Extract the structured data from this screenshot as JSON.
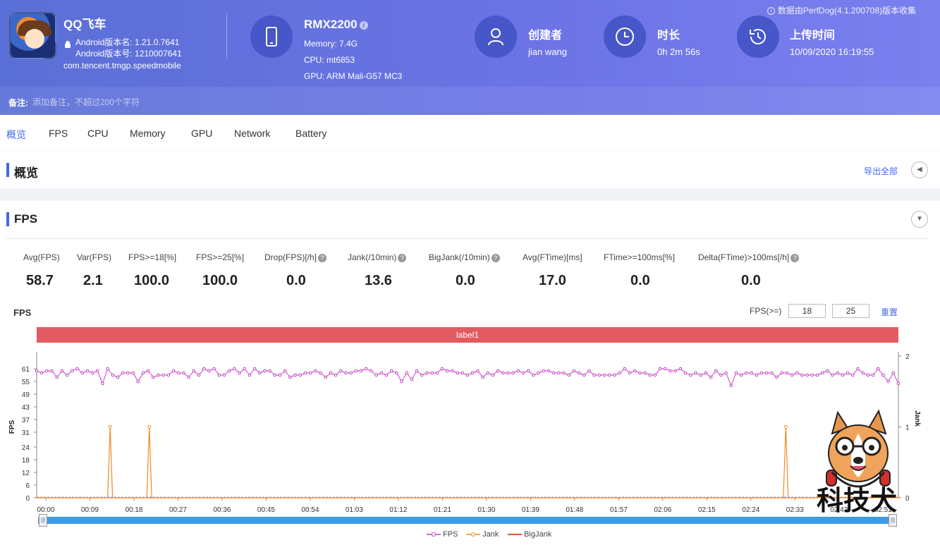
{
  "app": {
    "name": "QQ飞车",
    "version_name": "Android版本名: 1.21.0.7641",
    "version_code": "Android版本号: 1210007641",
    "package": "com.tencent.tmgp.speedmobile"
  },
  "device": {
    "name": "RMX2200",
    "memory": "Memory: 7.4G",
    "cpu": "CPU: mt6853",
    "gpu": "GPU: ARM Mali-G57 MC3"
  },
  "creator": {
    "title": "创建者",
    "value": "jian wang"
  },
  "duration": {
    "title": "时长",
    "value": "0h 2m 56s"
  },
  "upload": {
    "title": "上传时间",
    "value": "10/09/2020 16:19:55"
  },
  "perfdog_note": "数据由PerfDog(4.1.200708)版本收集",
  "note": {
    "label": "备注:",
    "placeholder": "添加备注，不超过200个字符"
  },
  "tabs": [
    "概览",
    "FPS",
    "CPU",
    "Memory",
    "GPU",
    "Network",
    "Battery"
  ],
  "overview": {
    "title": "概览",
    "export": "导出全部"
  },
  "fps_section": {
    "title": "FPS",
    "metrics": [
      {
        "label": "Avg(FPS)",
        "value": "58.7",
        "help": false
      },
      {
        "label": "Var(FPS)",
        "value": "2.1",
        "help": false
      },
      {
        "label": "FPS>=18[%]",
        "value": "100.0",
        "help": false
      },
      {
        "label": "FPS>=25[%]",
        "value": "100.0",
        "help": false
      },
      {
        "label": "Drop(FPS)[/h]",
        "value": "0.0",
        "help": true
      },
      {
        "label": "Jank(/10min)",
        "value": "13.6",
        "help": true
      },
      {
        "label": "BigJank(/10min)",
        "value": "0.0",
        "help": true
      },
      {
        "label": "Avg(FTime)[ms]",
        "value": "17.0",
        "help": false
      },
      {
        "label": "FTime>=100ms[%]",
        "value": "0.0",
        "help": false
      },
      {
        "label": "Delta(FTime)>100ms[/h]",
        "value": "0.0",
        "help": true
      }
    ],
    "chart_title": "FPS",
    "threshold_label": "FPS(>=)",
    "threshold_1": "18",
    "threshold_2": "25",
    "reset": "重置",
    "label_bar": "label1"
  },
  "watermark": "科技犬",
  "colors": {
    "header": "#5a6fd6",
    "accent": "#4169e1",
    "label_bar": "#e35a61",
    "fps": "#c43fc4",
    "jank": "#f08a24",
    "bigjank": "#e0552a",
    "slider": "#3a9be8"
  },
  "chart_data": {
    "type": "line",
    "title": "",
    "xlabel": "",
    "ylabel": "FPS",
    "y2label": "Jank",
    "y_ticks": [
      0,
      6,
      12,
      18,
      24,
      31,
      37,
      43,
      49,
      55,
      61
    ],
    "y_range": [
      0,
      67
    ],
    "y2_ticks": [
      0,
      1,
      2
    ],
    "y2_range": [
      0,
      2
    ],
    "x_ticks": [
      "00:00",
      "00:09",
      "00:18",
      "00:27",
      "00:36",
      "00:45",
      "00:54",
      "01:03",
      "01:12",
      "01:21",
      "01:30",
      "01:39",
      "01:48",
      "01:57",
      "02:06",
      "02:15",
      "02:24",
      "02:33",
      "02:42",
      "02:51"
    ],
    "x_range_seconds": [
      0,
      176
    ],
    "series": [
      {
        "name": "FPS",
        "values": [
          60,
          59,
          60,
          60,
          57,
          60,
          58,
          60,
          61,
          59,
          60,
          59,
          60,
          54,
          61,
          58,
          57,
          59,
          59,
          59,
          55,
          59,
          60,
          57,
          58,
          58,
          58,
          60,
          59,
          59,
          57,
          60,
          58,
          61,
          60,
          61,
          58,
          58,
          60,
          61,
          59,
          61,
          58,
          61,
          59,
          60,
          60,
          58,
          58,
          60,
          57,
          58,
          58,
          59,
          59,
          60,
          59,
          57,
          59,
          58,
          60,
          59,
          59,
          60,
          60,
          61,
          60,
          58,
          59,
          58,
          60,
          59,
          55,
          59,
          56,
          60,
          58,
          59,
          59,
          59,
          61,
          60,
          60,
          59,
          59,
          58,
          59,
          60,
          57,
          59,
          58,
          60,
          59,
          59,
          59,
          60,
          59,
          60,
          58,
          59,
          60,
          60,
          59,
          59,
          59,
          58,
          60,
          59,
          58,
          60,
          58,
          58,
          58,
          58,
          58,
          59,
          61,
          59,
          60,
          59,
          59,
          58,
          58,
          61,
          61,
          60,
          60,
          61,
          59,
          58,
          59,
          58,
          59,
          57,
          60,
          58,
          59,
          53,
          59,
          58,
          59,
          59,
          58,
          59,
          59,
          59,
          57,
          59,
          59,
          58,
          59,
          58,
          58,
          58,
          58,
          59,
          60,
          58,
          59,
          58,
          59,
          58,
          61,
          59,
          58,
          58,
          61,
          58,
          55,
          59,
          54
        ]
      },
      {
        "name": "Jank",
        "spikes_seconds": [
          15,
          23,
          153
        ],
        "spike_value": 1,
        "baseline": 0
      },
      {
        "name": "BigJank",
        "values_constant": 0
      }
    ],
    "legend": [
      "FPS",
      "Jank",
      "BigJank"
    ],
    "legend_position": "bottom-center",
    "grid": false
  }
}
